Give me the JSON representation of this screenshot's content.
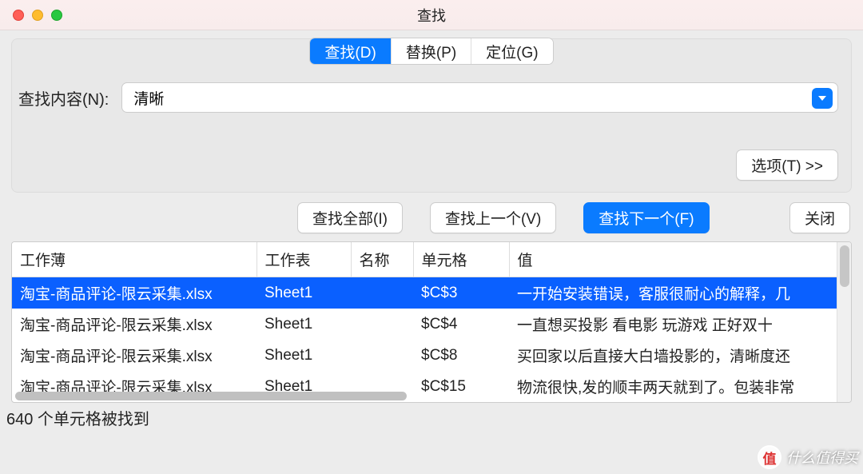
{
  "window": {
    "title": "查找"
  },
  "tabs": [
    {
      "label": "查找(D)",
      "active": true
    },
    {
      "label": "替换(P)",
      "active": false
    },
    {
      "label": "定位(G)",
      "active": false
    }
  ],
  "search": {
    "label": "查找内容(N):",
    "value": "清晰"
  },
  "buttons": {
    "options": "选项(T) >>",
    "find_all": "查找全部(I)",
    "find_prev": "查找上一个(V)",
    "find_next": "查找下一个(F)",
    "close": "关闭"
  },
  "results": {
    "columns": {
      "workbook": "工作薄",
      "worksheet": "工作表",
      "name": "名称",
      "cell": "单元格",
      "value": "值"
    },
    "rows": [
      {
        "workbook": "淘宝-商品评论-限云采集.xlsx",
        "worksheet": "Sheet1",
        "name": "",
        "cell": "$C$3",
        "value": "一开始安装错误，客服很耐心的解释，几",
        "selected": true
      },
      {
        "workbook": "淘宝-商品评论-限云采集.xlsx",
        "worksheet": "Sheet1",
        "name": "",
        "cell": "$C$4",
        "value": "一直想买投影 看电影 玩游戏   正好双十",
        "selected": false
      },
      {
        "workbook": "淘宝-商品评论-限云采集.xlsx",
        "worksheet": "Sheet1",
        "name": "",
        "cell": "$C$8",
        "value": "买回家以后直接大白墙投影的，清晰度还",
        "selected": false
      },
      {
        "workbook": "淘宝-商品评论-限云采集.xlsx",
        "worksheet": "Sheet1",
        "name": "",
        "cell": "$C$15",
        "value": "物流很快,发的顺丰两天就到了。包装非常",
        "selected": false
      }
    ]
  },
  "status": {
    "text": "640 个单元格被找到"
  },
  "watermark": {
    "badge": "值",
    "text": "什么值得买"
  }
}
